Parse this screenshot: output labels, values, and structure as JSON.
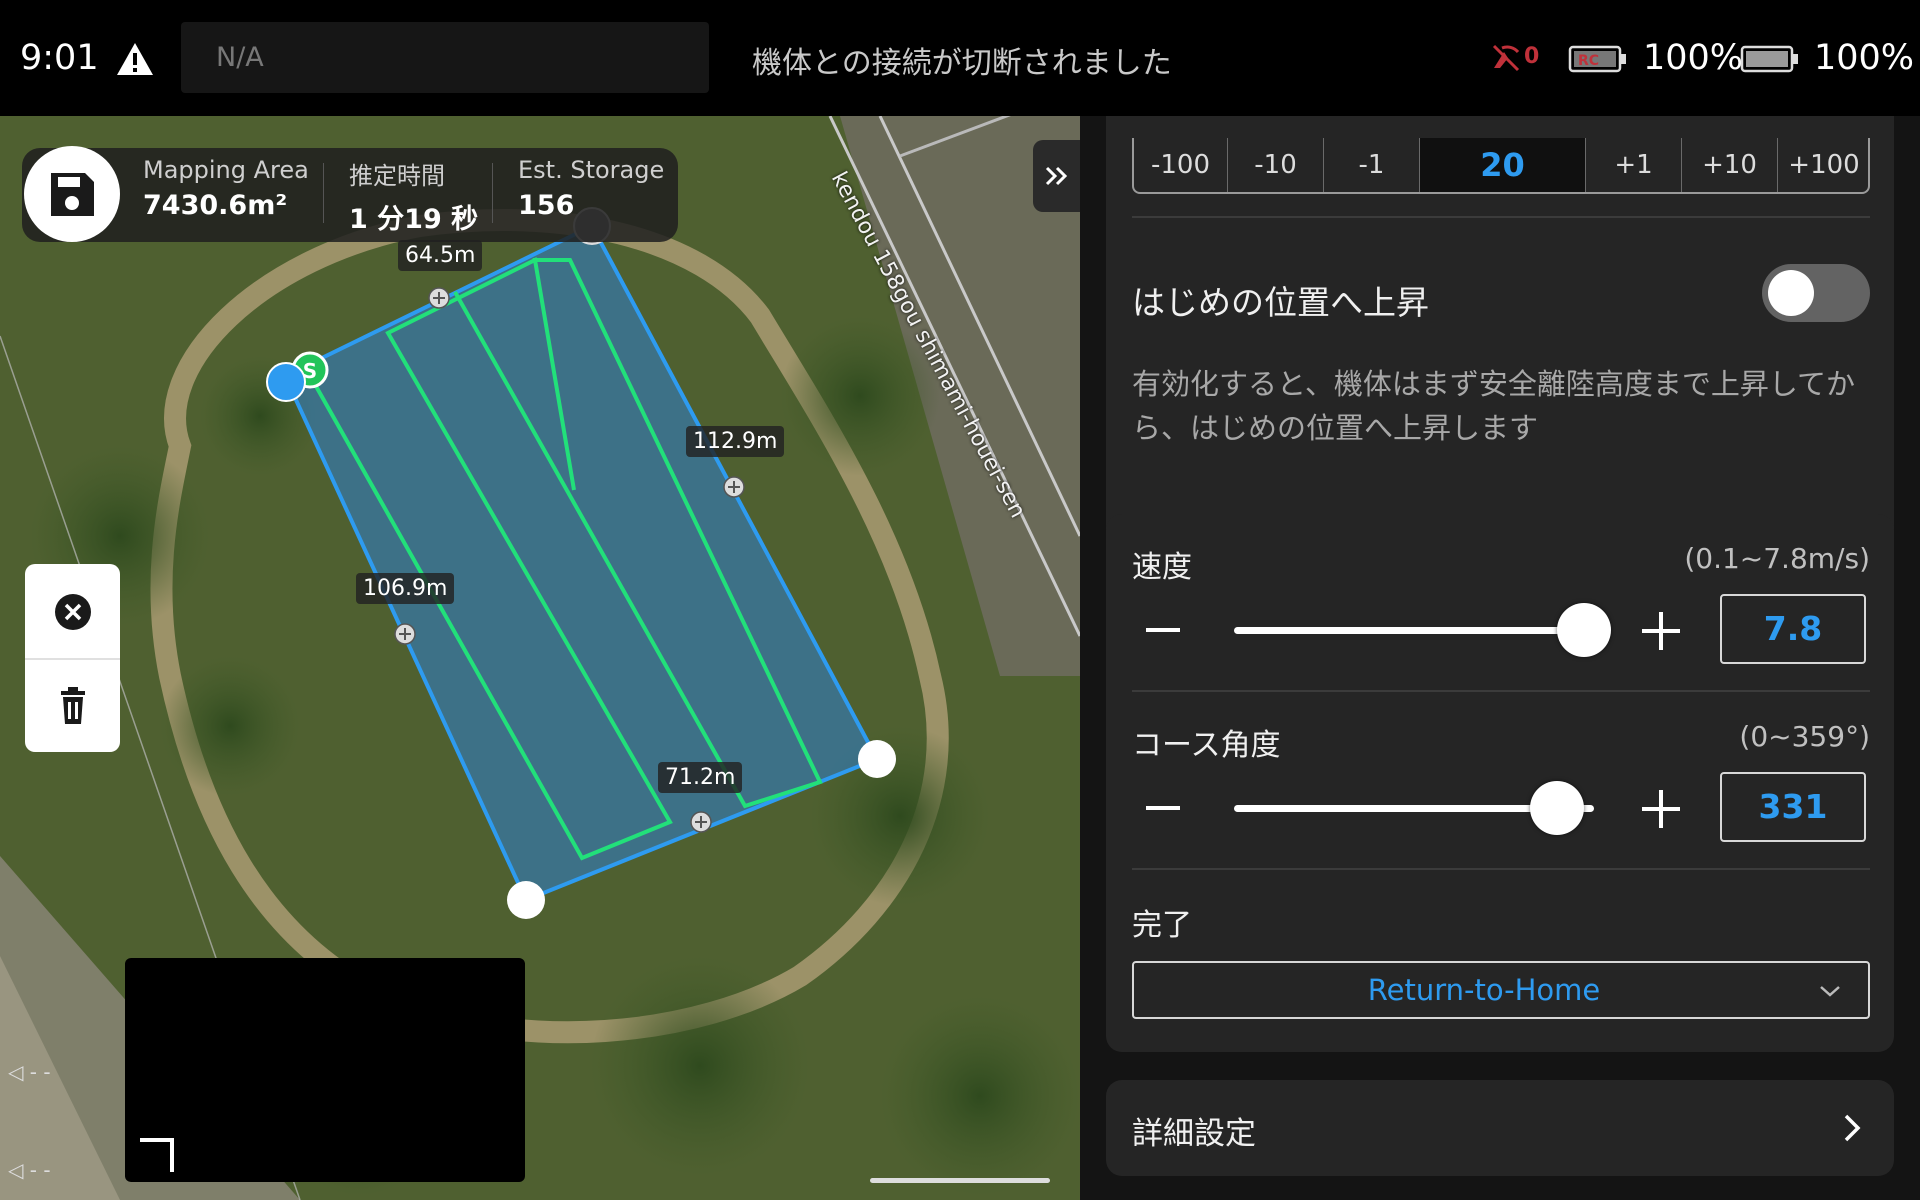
{
  "status_bar": {
    "time": "9:01",
    "flight_mode": "N/A",
    "connection_message": "機体との接続が切断されました",
    "signal_count": "0",
    "rc_battery": "100%",
    "drone_battery": "100%",
    "icons": [
      "warning-icon",
      "signal-lost-icon",
      "rc-battery-icon",
      "drone-battery-icon"
    ]
  },
  "map": {
    "road_name": "kendou 158gou shimami-houei-sen",
    "stats": [
      {
        "label": "Mapping Area",
        "value": "7430.6m²"
      },
      {
        "label": "推定時間",
        "value": "1 分19 秒"
      },
      {
        "label": "Est. Storage",
        "value": "156"
      }
    ],
    "edge_lengths": [
      "64.5m",
      "112.9m",
      "106.9m",
      "71.2m"
    ],
    "start_marker": "S",
    "colors": {
      "polygon_fill": "#2f7fd0",
      "polygon_edge": "#2e9bf0",
      "flight_path": "#22e07a"
    }
  },
  "panel": {
    "stepper": [
      "-100",
      "-10",
      "-1",
      "20",
      "+1",
      "+10",
      "+100"
    ],
    "ascend": {
      "label": "はじめの位置へ上昇",
      "enabled": false,
      "description": "有効化すると、機体はまず安全離陸高度まで上昇してから、はじめの位置へ上昇します"
    },
    "speed": {
      "label": "速度",
      "range": "(0.1~7.8m/s)",
      "value": "7.8",
      "slider_fraction": 1.0
    },
    "course_angle": {
      "label": "コース角度",
      "range": "(0~359°)",
      "value": "331",
      "slider_fraction": 0.92
    },
    "finish": {
      "label": "完了",
      "value": "Return-to-Home"
    },
    "advanced": {
      "label": "詳細設定"
    },
    "accent_color": "#2e9bf0"
  }
}
